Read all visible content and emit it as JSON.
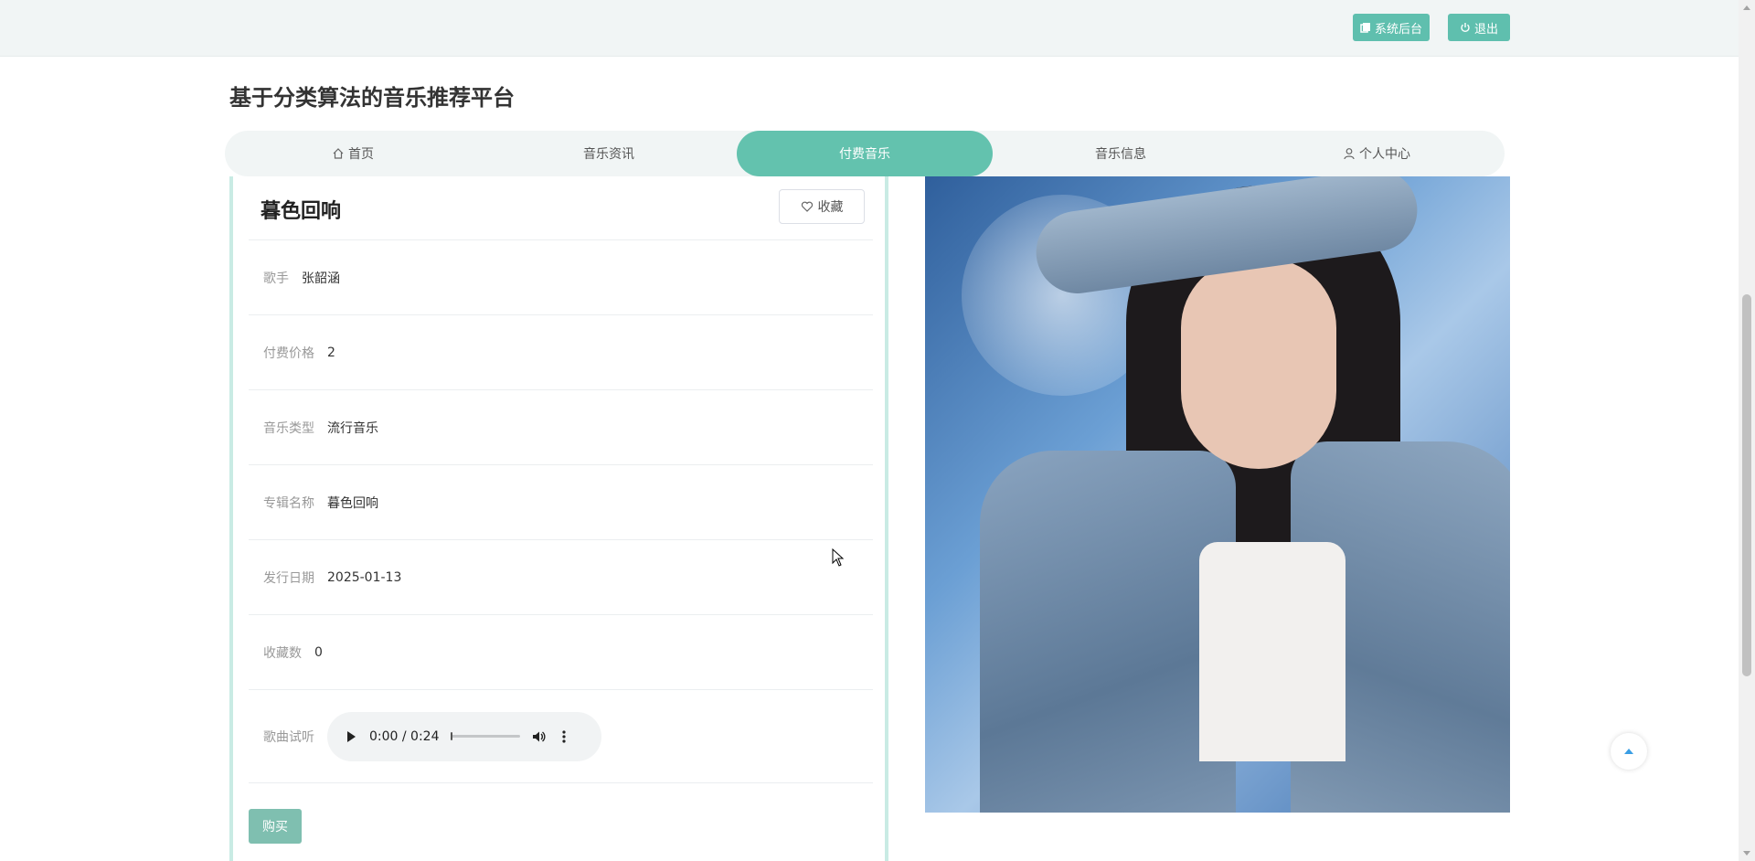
{
  "topbar": {
    "admin_label": "系统后台",
    "logout_label": "退出"
  },
  "site": {
    "title": "基于分类算法的音乐推荐平台"
  },
  "nav": {
    "items": [
      {
        "label": "首页",
        "icon": "home-icon"
      },
      {
        "label": "音乐资讯"
      },
      {
        "label": "付费音乐",
        "active": true
      },
      {
        "label": "音乐信息"
      },
      {
        "label": "个人中心",
        "icon": "user-icon"
      }
    ]
  },
  "song": {
    "title": "暮色回响",
    "favorite_label": "收藏",
    "fields": [
      {
        "label": "歌手",
        "value": "张韶涵"
      },
      {
        "label": "付费价格",
        "value": "2"
      },
      {
        "label": "音乐类型",
        "value": "流行音乐"
      },
      {
        "label": "专辑名称",
        "value": "暮色回响"
      },
      {
        "label": "发行日期",
        "value": "2025-01-13"
      },
      {
        "label": "收藏数",
        "value": "0"
      }
    ],
    "preview_label": "歌曲试听",
    "audio": {
      "time": "0:00 / 0:24",
      "progress": 0
    },
    "buy_label": "购买"
  },
  "colors": {
    "accent": "#63c2ae",
    "topbar_bg": "#f1f5f5"
  }
}
